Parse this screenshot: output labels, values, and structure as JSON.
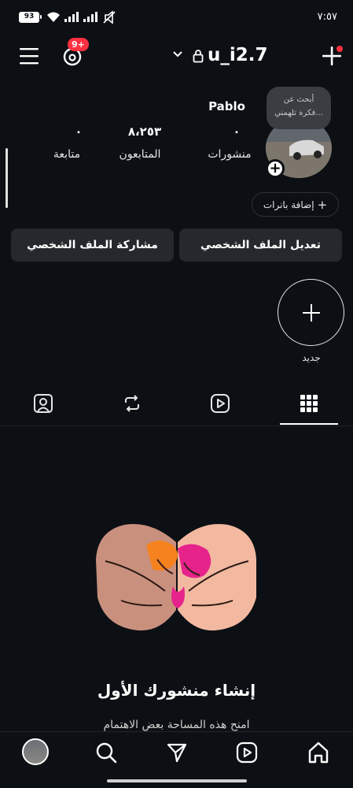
{
  "status_bar": {
    "battery": "93",
    "time": "٧:٥٧"
  },
  "header": {
    "notification_badge": "9+",
    "username": "u_i2.7"
  },
  "profile": {
    "display_name": "Pablo",
    "note_text_line1": "أبحث عن",
    "note_text_line2": "فكرة تلهمني...",
    "stats": [
      {
        "value": "٠",
        "label": "منشورات"
      },
      {
        "value": "٨،٢٥٣",
        "label": "المتابعون"
      },
      {
        "value": "٠",
        "label": "متابعة"
      }
    ],
    "add_banners_label": "إضافة بانرات"
  },
  "actions": {
    "edit_profile": "تعديل الملف الشخصي",
    "share_profile": "مشاركة الملف الشخصي"
  },
  "highlight": {
    "new_label": "جديد"
  },
  "tabs": [
    "grid-icon",
    "reels-icon",
    "reposts-icon",
    "tagged-icon"
  ],
  "empty_state": {
    "title": "إنشاء منشورك الأول",
    "subtitle": "امنح هذه المساحة بعض الاهتمام"
  },
  "colors": {
    "background": "#0c1014",
    "badge": "#ff3040",
    "button": "#25292e",
    "accent_orange": "#f5821f",
    "accent_pink": "#e6238a"
  }
}
